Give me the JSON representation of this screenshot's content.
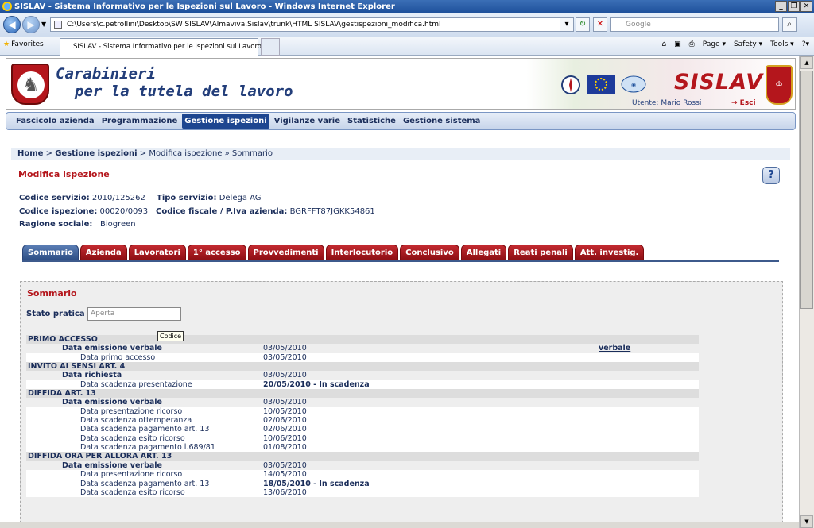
{
  "browser": {
    "window_title": "SISLAV - Sistema Informativo per le Ispezioni sul Lavoro - Windows Internet Explorer",
    "address": "C:\\Users\\c.petrollini\\Desktop\\SW SISLAV\\Almaviva.Sislav\\trunk\\HTML SISLAV\\gestispezioni_modifica.html",
    "search_placeholder": "Google",
    "favorites": "Favorites",
    "tab_title": "SISLAV - Sistema Informativo per le Ispezioni sul Lavoro",
    "tools": [
      "Page ▾",
      "Safety ▾",
      "Tools ▾",
      "?▾"
    ]
  },
  "header": {
    "brand_line1": "Carabinieri",
    "brand_line2": "per la tutela del lavoro",
    "app_name": "SISLAV",
    "user": "Utente: Mario Rossi",
    "logout": "→ Esci"
  },
  "menu": [
    "Fascicolo azienda",
    "Programmazione",
    "Gestione ispezioni",
    "Vigilanze varie",
    "Statistiche",
    "Gestione sistema"
  ],
  "menu_active": "Gestione ispezioni",
  "breadcrumb": {
    "home": "Home",
    "sep": " > ",
    "section": "Gestione ispezioni",
    "rest": " > Modifica ispezione » Sommario"
  },
  "page_title": "Modifica ispezione",
  "info": {
    "codice_servizio_label": "Codice servizio:",
    "codice_servizio": "2010/125262",
    "tipo_servizio_label": "Tipo servizio:",
    "tipo_servizio": "Delega AG",
    "codice_ispezione_label": "Codice ispezione:",
    "codice_ispezione": "00020/0093",
    "codice_fiscale_label": "Codice fiscale / P.Iva azienda:",
    "codice_fiscale": "BGRFFT87JGKK54861",
    "ragione_sociale_label": "Ragione sociale:",
    "ragione_sociale": "Biogreen"
  },
  "tabs": [
    "Sommario",
    "Azienda",
    "Lavoratori",
    "1° accesso",
    "Provvedimenti",
    "Interlocutorio",
    "Conclusivo",
    "Allegati",
    "Reati penali",
    "Att. investig."
  ],
  "panel": {
    "title": "Sommario",
    "stato_label": "Stato pratica",
    "stato_value": "Aperta",
    "tooltip": "Codice"
  },
  "rows": [
    {
      "t": "hdr",
      "k": "PRIMO ACCESSO"
    },
    {
      "t": "key",
      "k": "Data emissione verbale",
      "v": "03/05/2010",
      "link": "verbale"
    },
    {
      "t": "sub",
      "k": "Data primo accesso",
      "v": "03/05/2010"
    },
    {
      "t": "hdr",
      "k": "INVITO AI SENSI ART. 4"
    },
    {
      "t": "key",
      "k": "Data richiesta",
      "v": "03/05/2010"
    },
    {
      "t": "sub",
      "k": "Data scadenza presentazione",
      "v": "20/05/2010 - In scadenza",
      "bold": true
    },
    {
      "t": "hdr",
      "k": "DIFFIDA ART. 13"
    },
    {
      "t": "key",
      "k": "Data emissione verbale",
      "v": "03/05/2010"
    },
    {
      "t": "sub",
      "k": "Data presentazione ricorso",
      "v": "10/05/2010"
    },
    {
      "t": "sub",
      "k": "Data scadenza ottemperanza",
      "v": "02/06/2010"
    },
    {
      "t": "sub",
      "k": "Data scadenza pagamento art. 13",
      "v": "02/06/2010"
    },
    {
      "t": "sub",
      "k": "Data scadenza esito ricorso",
      "v": "10/06/2010"
    },
    {
      "t": "sub",
      "k": "Data scadenza pagamento l.689/81",
      "v": "01/08/2010"
    },
    {
      "t": "hdr",
      "k": "DIFFIDA ORA PER ALLORA ART. 13"
    },
    {
      "t": "key",
      "k": "Data emissione verbale",
      "v": "03/05/2010"
    },
    {
      "t": "sub",
      "k": "Data presentazione ricorso",
      "v": "14/05/2010"
    },
    {
      "t": "sub",
      "k": "Data scadenza pagamento art. 13",
      "v": "18/05/2010 - In scadenza",
      "bold": true
    },
    {
      "t": "sub",
      "k": "Data scadenza esito ricorso",
      "v": "13/06/2010"
    }
  ]
}
